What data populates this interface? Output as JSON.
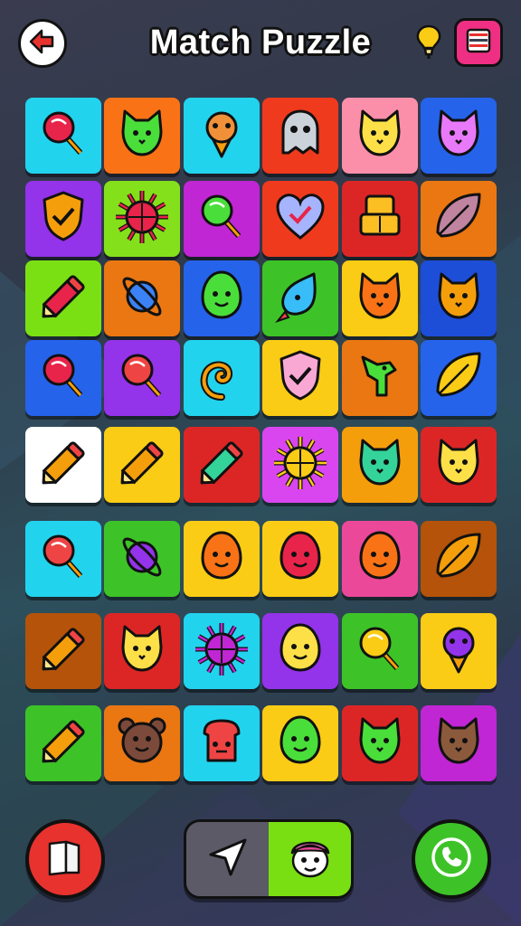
{
  "header": {
    "title": "Match Puzzle",
    "back_icon": "back-arrow-icon",
    "hint_icon": "lightbulb-icon",
    "menu_icon": "menu-icon"
  },
  "colors": {
    "menu_button": "#ef2f83",
    "left_button": "#e8322e",
    "right_button": "#3dc328",
    "pill_left": "#5b5a66",
    "pill_right": "#79df12"
  },
  "board": {
    "rows": [
      [
        {
          "bg": "#22d3ee",
          "icon": "lollipop-icon",
          "fg": "#e8244a"
        },
        {
          "bg": "#f97316",
          "icon": "cat-face-icon",
          "fg": "#4ade3a"
        },
        {
          "bg": "#22d3ee",
          "icon": "ice-cream-icon",
          "fg": "#f0913a"
        },
        {
          "bg": "#ef3a1d",
          "icon": "ghost-icon",
          "fg": "#cbd2da"
        },
        {
          "bg": "#fb8faa",
          "icon": "cat-face-icon",
          "fg": "#fde047"
        },
        {
          "bg": "#2563eb",
          "icon": "cat-face-icon",
          "fg": "#e879f9"
        }
      ],
      [
        {
          "bg": "#9333ea",
          "icon": "shield-icon",
          "fg": "#f59e0b"
        },
        {
          "bg": "#84e01a",
          "icon": "sun-icon",
          "fg": "#e8244a"
        },
        {
          "bg": "#c026d3",
          "icon": "lollipop-icon",
          "fg": "#4ade3a"
        },
        {
          "bg": "#ef3a1d",
          "icon": "heart-icon",
          "fg": "#a5b4fc"
        },
        {
          "bg": "#dc2626",
          "icon": "robot-icon",
          "fg": "#fbbf24"
        },
        {
          "bg": "#ea7712",
          "icon": "leaf-icon",
          "fg": "#c084a0"
        }
      ],
      [
        {
          "bg": "#7ae014",
          "icon": "pencil-icon",
          "fg": "#e8244a"
        },
        {
          "bg": "#ea7712",
          "icon": "planet-icon",
          "fg": "#3b82f6"
        },
        {
          "bg": "#2563eb",
          "icon": "blob-face-icon",
          "fg": "#4ade3a"
        },
        {
          "bg": "#3dc328",
          "icon": "drop-icon",
          "fg": "#38bdf8"
        },
        {
          "bg": "#facc15",
          "icon": "cat-face-icon",
          "fg": "#f97316"
        },
        {
          "bg": "#1d4ed8",
          "icon": "cat-face-icon",
          "fg": "#f59e0b"
        }
      ],
      [
        {
          "bg": "#2563eb",
          "icon": "lollipop-icon",
          "fg": "#e8244a"
        },
        {
          "bg": "#9333ea",
          "icon": "lollipop-icon",
          "fg": "#ef4444"
        },
        {
          "bg": "#22d3ee",
          "icon": "swirl-icon",
          "fg": "#f59e0b"
        },
        {
          "bg": "#facc15",
          "icon": "shield-icon",
          "fg": "#f9a8d4"
        },
        {
          "bg": "#ea7712",
          "icon": "dino-icon",
          "fg": "#4ade3a"
        },
        {
          "bg": "#2563eb",
          "icon": "leaf-icon",
          "fg": "#facc15"
        }
      ],
      [
        {
          "bg": "#ffffff",
          "icon": "pencil-icon",
          "fg": "#f59e0b"
        },
        {
          "bg": "#facc15",
          "icon": "pencil-icon",
          "fg": "#f59e0b"
        },
        {
          "bg": "#dc2626",
          "icon": "pencil-icon",
          "fg": "#34d399"
        },
        {
          "bg": "#d946ef",
          "icon": "sun-icon",
          "fg": "#facc15"
        },
        {
          "bg": "#f59e0b",
          "icon": "cat-face-icon",
          "fg": "#34d399"
        },
        {
          "bg": "#dc2626",
          "icon": "cat-face-icon",
          "fg": "#fde047"
        }
      ],
      [
        {
          "bg": "#22d3ee",
          "icon": "lollipop-icon",
          "fg": "#ef4444"
        },
        {
          "bg": "#3dc328",
          "icon": "planet-icon",
          "fg": "#9333ea"
        },
        {
          "bg": "#facc15",
          "icon": "blob-face-icon",
          "fg": "#f97316"
        },
        {
          "bg": "#facc15",
          "icon": "blob-face-icon",
          "fg": "#e8244a"
        },
        {
          "bg": "#ec4899",
          "icon": "blob-face-icon",
          "fg": "#f97316"
        },
        {
          "bg": "#b45309",
          "icon": "leaf-icon",
          "fg": "#f59e0b"
        }
      ],
      [
        {
          "bg": "#b45309",
          "icon": "pencil-icon",
          "fg": "#f59e0b"
        },
        {
          "bg": "#dc2626",
          "icon": "cat-face-icon",
          "fg": "#fde047"
        },
        {
          "bg": "#22d3ee",
          "icon": "sun-icon",
          "fg": "#c026d3"
        },
        {
          "bg": "#9333ea",
          "icon": "blob-face-icon",
          "fg": "#fde047"
        },
        {
          "bg": "#3dc328",
          "icon": "lollipop-icon",
          "fg": "#facc15"
        },
        {
          "bg": "#facc15",
          "icon": "ice-cream-icon",
          "fg": "#9333ea"
        }
      ],
      [
        {
          "bg": "#3dc328",
          "icon": "pencil-icon",
          "fg": "#f59e0b"
        },
        {
          "bg": "#ea7712",
          "icon": "bear-face-icon",
          "fg": "#7c4a3a"
        },
        {
          "bg": "#22d3ee",
          "icon": "toast-icon",
          "fg": "#ef4444"
        },
        {
          "bg": "#facc15",
          "icon": "blob-face-icon",
          "fg": "#4ade3a"
        },
        {
          "bg": "#dc2626",
          "icon": "cat-face-icon",
          "fg": "#4ade3a"
        },
        {
          "bg": "#c026d3",
          "icon": "cat-face-icon",
          "fg": "#8b5a3c"
        }
      ]
    ]
  },
  "footer": {
    "left_icon": "book-icon",
    "pill_left_icon": "cursor-arrow-icon",
    "pill_right_icon": "character-face-icon",
    "right_icon": "phone-icon"
  }
}
